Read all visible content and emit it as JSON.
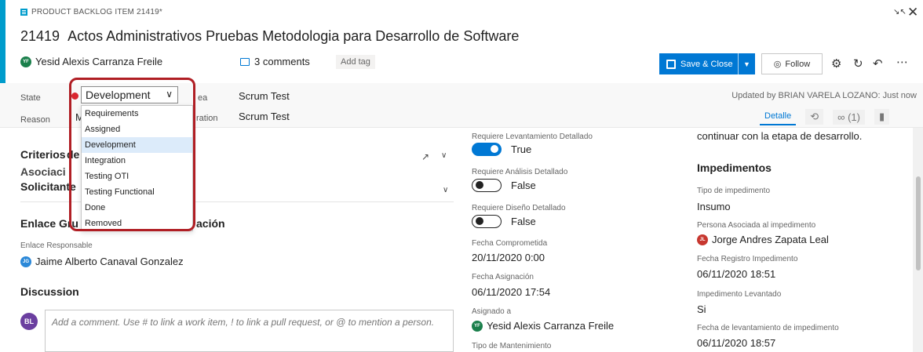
{
  "header": {
    "type_label": "PRODUCT BACKLOG ITEM 21419*",
    "id": "21419",
    "title": "Actos Administrativos Pruebas Metodologia para Desarrollo de Software",
    "assignee": {
      "initials": "YF",
      "name": "Yesid Alexis Carranza Freile"
    },
    "comments": "3 comments",
    "add_tag": "Add tag",
    "save_close": "Save & Close",
    "follow": "Follow"
  },
  "fields": {
    "state_label": "State",
    "state_value": "Development",
    "reason_label": "Reason",
    "reason_value": "M",
    "area_label": "Area",
    "area_label_visible": "A",
    "area_label_tail": "ea",
    "area_value": "Scrum Test",
    "iteration_label_tail": "ration",
    "iteration_value": "Scrum Test",
    "updated": "Updated by BRIAN VARELA LOZANO: Just now"
  },
  "tabs": {
    "detalle": "Detalle",
    "links": "(1)"
  },
  "state_options": [
    "Requirements",
    "Assigned",
    "Development",
    "Integration",
    "Testing OTI",
    "Testing Functional",
    "Done",
    "Removed"
  ],
  "left": {
    "criterios_title": "Criterios",
    "criterios_tail": "de",
    "asociacion": "Asociaci",
    "solicitante": "Solicitante",
    "enlace_title": "Enlace Gru",
    "enlace_title_tail": "ación",
    "enlace_resp_label": "Enlace Responsable",
    "enlace_resp": {
      "initials": "JG",
      "name": "Jaime Alberto Canaval Gonzalez"
    },
    "discussion_title": "Discussion",
    "comment_avatar": "BL",
    "comment_placeholder": "Add a comment. Use # to link a work item, ! to link a pull request, or @ to mention a person."
  },
  "middle": {
    "lev_label": "Requiere Levantamiento Detallado",
    "lev_value": "True",
    "analisis_label": "Requiere Análisis Detallado",
    "analisis_value": "False",
    "diseno_label": "Requiere Diseño Detallado",
    "diseno_value": "False",
    "fecha_comp_label": "Fecha Comprometida",
    "fecha_comp": "20/11/2020 0:00",
    "fecha_asig_label": "Fecha Asignación",
    "fecha_asig": "06/11/2020 17:54",
    "asignado_label": "Asignado a",
    "asignado": {
      "initials": "YF",
      "name": "Yesid Alexis Carranza Freile"
    },
    "tipo_mant_label": "Tipo de Mantenimiento"
  },
  "right": {
    "top_text": "continuar con la etapa de desarrollo.",
    "impedimentos_title": "Impedimentos",
    "tipo_imp_label": "Tipo de impedimento",
    "tipo_imp": "Insumo",
    "persona_label": "Persona Asociada al impedimento",
    "persona": {
      "initials": "JL",
      "name": "Jorge Andres Zapata Leal"
    },
    "fecha_reg_label": "Fecha Registro Impedimento",
    "fecha_reg": "06/11/2020 18:51",
    "levantado_label": "Impedimento Levantado",
    "levantado": "Si",
    "fecha_lev_label": "Fecha de levantamiento de impedimento",
    "fecha_lev": "06/11/2020 18:57"
  },
  "colors": {
    "accent": "#009ccc",
    "primary": "#0078d4",
    "highlight": "#b01e24",
    "state_dot": "#d9262f"
  }
}
